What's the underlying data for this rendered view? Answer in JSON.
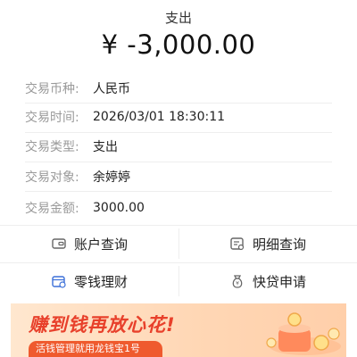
{
  "header": {
    "type_label": "支出",
    "amount": "¥ -3,000.00"
  },
  "details": [
    {
      "label": "交易币种:",
      "value": "人民币"
    },
    {
      "label": "交易时间:",
      "value": "2026/03/01 18:30:11"
    },
    {
      "label": "交易类型:",
      "value": "支出"
    },
    {
      "label": "交易对象:",
      "value": "余婷婷"
    },
    {
      "label": "交易金额:",
      "value": "3000.00"
    }
  ],
  "actions": {
    "account_query": "账户查询",
    "detail_query": "明细查询",
    "change_finance": "零钱理财",
    "quick_loan": "快贷申请"
  },
  "banner": {
    "title": "赚到钱再放心花!",
    "subtitle": "活钱管理就用龙钱宝1号"
  },
  "colors": {
    "accent": "#e8402b",
    "icon_blue": "#3b6fd8",
    "label_gray": "#9a9a9a"
  },
  "icons": [
    "wallet-icon",
    "detail-list-icon",
    "coin-box-icon",
    "money-bag-icon"
  ]
}
